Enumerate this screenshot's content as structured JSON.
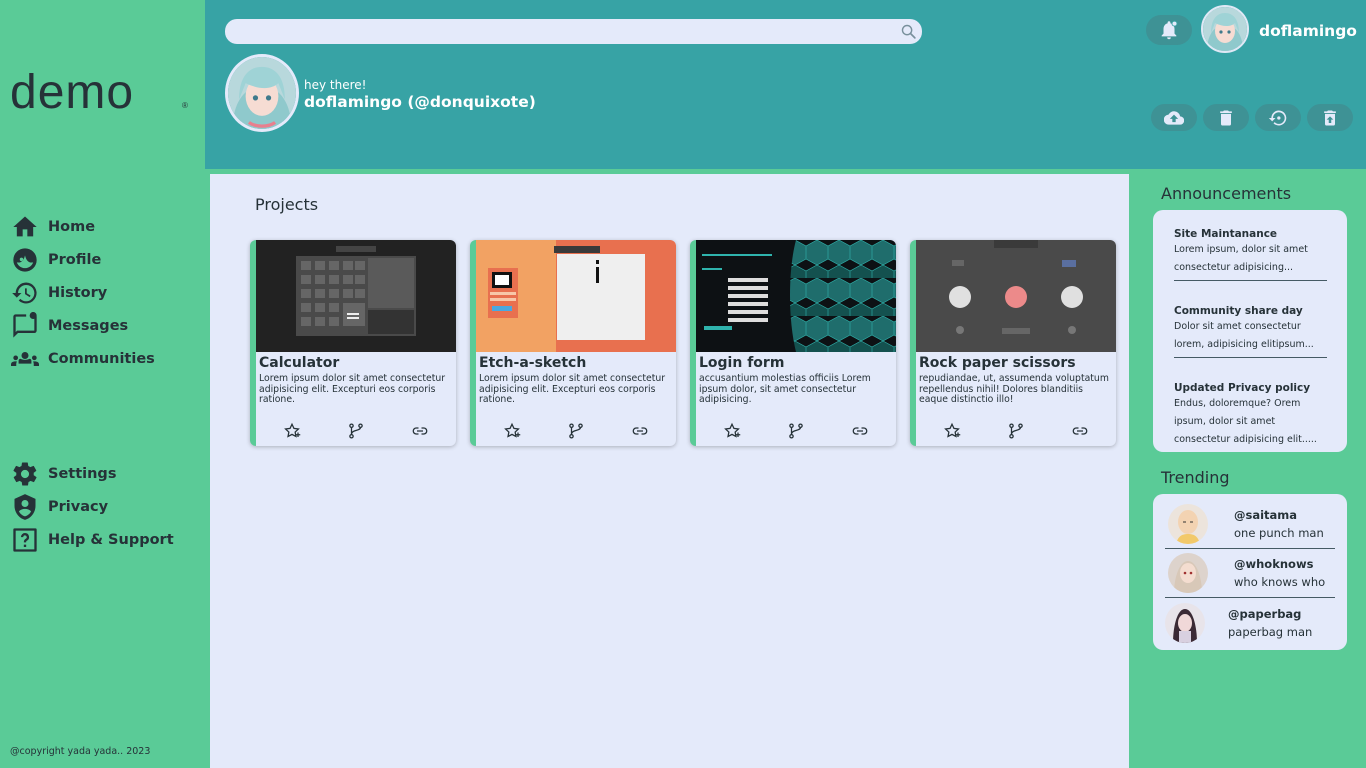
{
  "brand": {
    "logo_text": "demo",
    "logo_mark": "®"
  },
  "search": {
    "placeholder": "",
    "value": ""
  },
  "user": {
    "top_name": "doflamingo",
    "greeting": "hey there!",
    "display": "doflamingo (@donquixote)"
  },
  "sidebar": {
    "items": [
      {
        "label": "Home",
        "icon": "home-icon"
      },
      {
        "label": "Profile",
        "icon": "profile-icon"
      },
      {
        "label": "History",
        "icon": "history-icon"
      },
      {
        "label": "Messages",
        "icon": "messages-icon"
      },
      {
        "label": "Communities",
        "icon": "communities-icon"
      }
    ],
    "lower_items": [
      {
        "label": "Settings",
        "icon": "gear-icon"
      },
      {
        "label": "Privacy",
        "icon": "shield-icon"
      },
      {
        "label": "Help & Support",
        "icon": "help-icon"
      }
    ],
    "copyright": "@copyright yada yada.. 2023"
  },
  "main": {
    "title": "Projects",
    "projects": [
      {
        "title": "Calculator",
        "desc": "Lorem ipsum dolor sit amet consectetur adipisicing elit. Excepturi eos corporis ratione."
      },
      {
        "title": "Etch-a-sketch",
        "desc": "Lorem ipsum dolor sit amet consectetur adipisicing elit. Excepturi eos corporis ratione."
      },
      {
        "title": "Login form",
        "desc": "accusantium molestias officiis Lorem ipsum dolor, sit amet consectetur adipisicing."
      },
      {
        "title": "Rock paper scissors",
        "desc": "repudiandae, ut, assumenda voluptatum repellendus nihil! Dolores blanditiis eaque distinctio illo!"
      }
    ]
  },
  "announcements": {
    "title": "Announcements",
    "items": [
      {
        "title": "Site Maintanance",
        "text": "Lorem ipsum, dolor sit amet consectetur adipisicing..."
      },
      {
        "title": "Community share day",
        "text": "Dolor sit amet consectetur lorem, adipisicing elitipsum..."
      },
      {
        "title": "Updated Privacy policy",
        "text": "Endus, doloremque? Orem ipsum, dolor sit amet consectetur adipisicing elit....."
      }
    ]
  },
  "trending": {
    "title": "Trending",
    "items": [
      {
        "handle": "@saitama",
        "name": "one punch man"
      },
      {
        "handle": "@whoknows",
        "name": "who knows who"
      },
      {
        "handle": "@paperbag",
        "name": "paperbag man"
      }
    ]
  },
  "colors": {
    "green": "#5acb97",
    "teal": "#37a3a5",
    "panel": "#e4eafa",
    "text": "#263238"
  }
}
